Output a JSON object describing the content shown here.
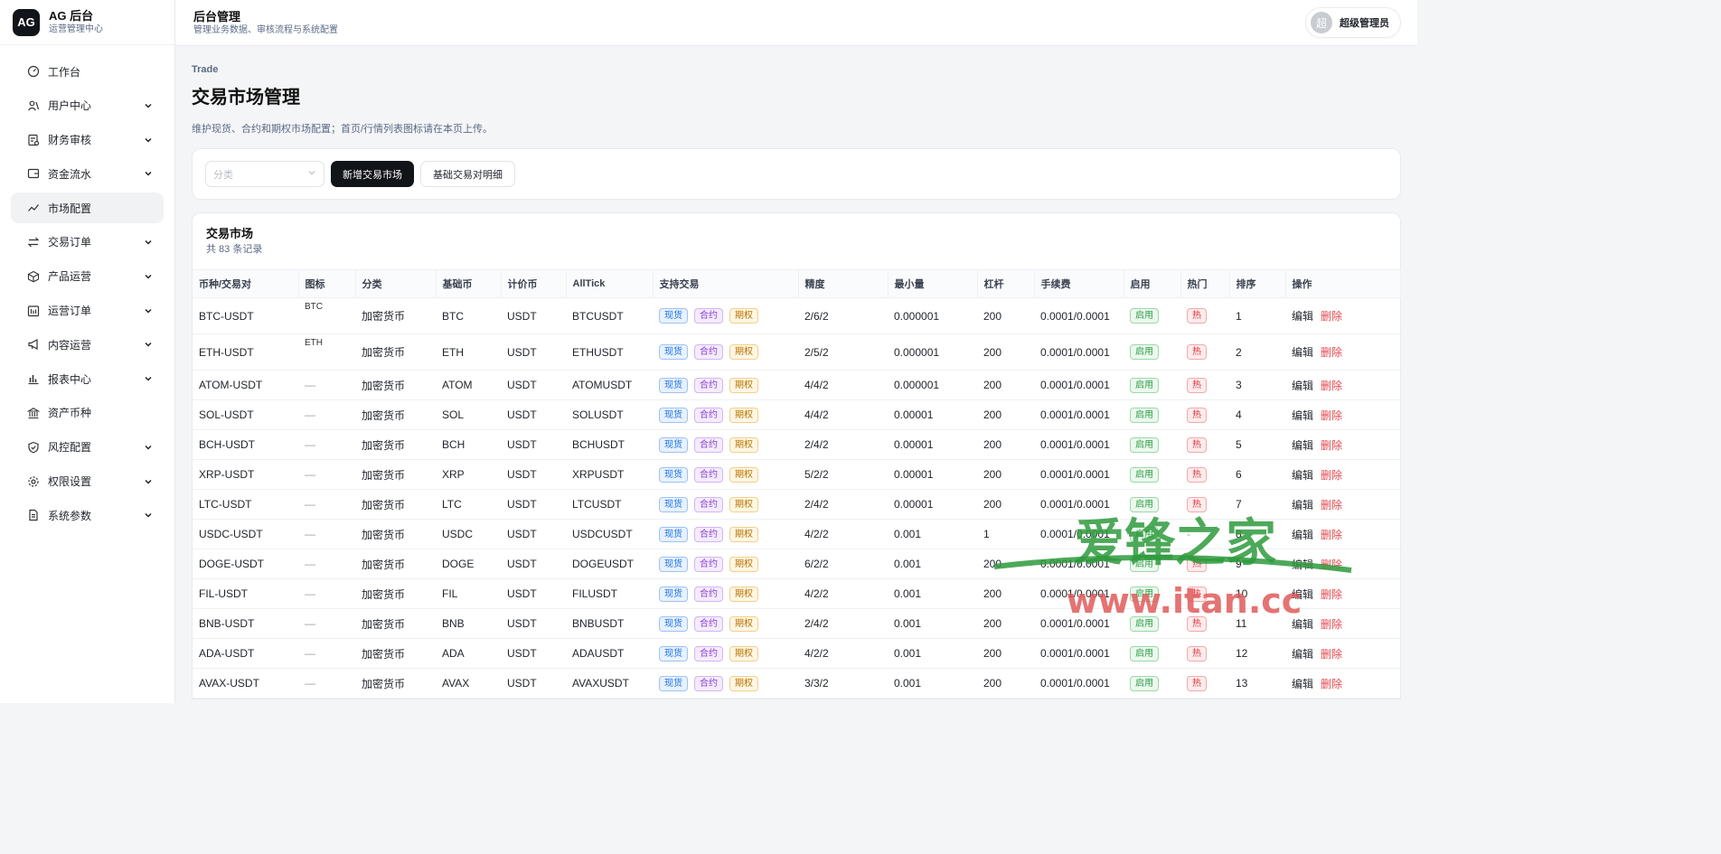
{
  "brand": {
    "logo": "AG",
    "title": "AG 后台",
    "subtitle": "运营管理中心"
  },
  "sidebar": {
    "items": [
      {
        "label": "工作台",
        "icon": "dashboard-icon",
        "expandable": false,
        "active": false
      },
      {
        "label": "用户中心",
        "icon": "users-icon",
        "expandable": true,
        "active": false
      },
      {
        "label": "财务审核",
        "icon": "finance-audit-icon",
        "expandable": true,
        "active": false
      },
      {
        "label": "资金流水",
        "icon": "wallet-icon",
        "expandable": true,
        "active": false
      },
      {
        "label": "市场配置",
        "icon": "chart-line-icon",
        "expandable": false,
        "active": true
      },
      {
        "label": "交易订单",
        "icon": "exchange-icon",
        "expandable": true,
        "active": false
      },
      {
        "label": "产品运营",
        "icon": "box-icon",
        "expandable": true,
        "active": false
      },
      {
        "label": "运营订单",
        "icon": "calendar-icon",
        "expandable": true,
        "active": false
      },
      {
        "label": "内容运营",
        "icon": "megaphone-icon",
        "expandable": true,
        "active": false
      },
      {
        "label": "报表中心",
        "icon": "bar-chart-icon",
        "expandable": true,
        "active": false
      },
      {
        "label": "资产币种",
        "icon": "bank-icon",
        "expandable": false,
        "active": false
      },
      {
        "label": "风控配置",
        "icon": "shield-icon",
        "expandable": true,
        "active": false
      },
      {
        "label": "权限设置",
        "icon": "gear-icon",
        "expandable": true,
        "active": false
      },
      {
        "label": "系统参数",
        "icon": "document-icon",
        "expandable": true,
        "active": false
      }
    ]
  },
  "topbar": {
    "title": "后台管理",
    "subtitle": "管理业务数据、审核流程与系统配置",
    "user_avatar": "超",
    "user_name": "超级管理员"
  },
  "page": {
    "breadcrumb": "Trade",
    "title": "交易市场管理",
    "description": "维护现货、合约和期权市场配置；首页/行情列表图标请在本页上传。"
  },
  "filters": {
    "category_placeholder": "分类",
    "add_button": "新增交易市场",
    "detail_button": "基础交易对明细"
  },
  "table": {
    "title": "交易市场",
    "count": "共 83 条记录",
    "columns": [
      "币种/交易对",
      "图标",
      "分类",
      "基础币",
      "计价币",
      "AllTick",
      "支持交易",
      "精度",
      "最小量",
      "杠杆",
      "手续费",
      "启用",
      "热门",
      "排序",
      "操作"
    ],
    "trade_tags": {
      "spot": "现货",
      "contract": "合约",
      "option": "期权"
    },
    "enabled_label": "启用",
    "hot_label": "热",
    "edit_label": "编辑",
    "delete_label": "删除",
    "rows": [
      {
        "pair": "BTC-USDT",
        "icon": "BTC",
        "category": "加密货币",
        "base": "BTC",
        "quote": "USDT",
        "alltick": "BTCUSDT",
        "precision": "2/6/2",
        "min": "0.000001",
        "leverage": "200",
        "fee": "0.0001/0.0001",
        "hot": "热",
        "sort": "1"
      },
      {
        "pair": "ETH-USDT",
        "icon": "ETH",
        "category": "加密货币",
        "base": "ETH",
        "quote": "USDT",
        "alltick": "ETHUSDT",
        "precision": "2/5/2",
        "min": "0.000001",
        "leverage": "200",
        "fee": "0.0001/0.0001",
        "hot": "热",
        "sort": "2"
      },
      {
        "pair": "ATOM-USDT",
        "icon": "—",
        "category": "加密货币",
        "base": "ATOM",
        "quote": "USDT",
        "alltick": "ATOMUSDT",
        "precision": "4/4/2",
        "min": "0.000001",
        "leverage": "200",
        "fee": "0.0001/0.0001",
        "hot": "热",
        "sort": "3"
      },
      {
        "pair": "SOL-USDT",
        "icon": "—",
        "category": "加密货币",
        "base": "SOL",
        "quote": "USDT",
        "alltick": "SOLUSDT",
        "precision": "4/4/2",
        "min": "0.00001",
        "leverage": "200",
        "fee": "0.0001/0.0001",
        "hot": "热",
        "sort": "4"
      },
      {
        "pair": "BCH-USDT",
        "icon": "—",
        "category": "加密货币",
        "base": "BCH",
        "quote": "USDT",
        "alltick": "BCHUSDT",
        "precision": "2/4/2",
        "min": "0.00001",
        "leverage": "200",
        "fee": "0.0001/0.0001",
        "hot": "热",
        "sort": "5"
      },
      {
        "pair": "XRP-USDT",
        "icon": "—",
        "category": "加密货币",
        "base": "XRP",
        "quote": "USDT",
        "alltick": "XRPUSDT",
        "precision": "5/2/2",
        "min": "0.00001",
        "leverage": "200",
        "fee": "0.0001/0.0001",
        "hot": "热",
        "sort": "6"
      },
      {
        "pair": "LTC-USDT",
        "icon": "—",
        "category": "加密货币",
        "base": "LTC",
        "quote": "USDT",
        "alltick": "LTCUSDT",
        "precision": "2/4/2",
        "min": "0.00001",
        "leverage": "200",
        "fee": "0.0001/0.0001",
        "hot": "热",
        "sort": "7"
      },
      {
        "pair": "USDC-USDT",
        "icon": "—",
        "category": "加密货币",
        "base": "USDC",
        "quote": "USDT",
        "alltick": "USDCUSDT",
        "precision": "4/2/2",
        "min": "0.001",
        "leverage": "1",
        "fee": "0.0001/0.0001",
        "hot": "-",
        "sort": "8"
      },
      {
        "pair": "DOGE-USDT",
        "icon": "—",
        "category": "加密货币",
        "base": "DOGE",
        "quote": "USDT",
        "alltick": "DOGEUSDT",
        "precision": "6/2/2",
        "min": "0.001",
        "leverage": "200",
        "fee": "0.0001/0.0001",
        "hot": "热",
        "sort": "9"
      },
      {
        "pair": "FIL-USDT",
        "icon": "—",
        "category": "加密货币",
        "base": "FIL",
        "quote": "USDT",
        "alltick": "FILUSDT",
        "precision": "4/2/2",
        "min": "0.001",
        "leverage": "200",
        "fee": "0.0001/0.0001",
        "hot": "热",
        "sort": "10"
      },
      {
        "pair": "BNB-USDT",
        "icon": "—",
        "category": "加密货币",
        "base": "BNB",
        "quote": "USDT",
        "alltick": "BNBUSDT",
        "precision": "2/4/2",
        "min": "0.001",
        "leverage": "200",
        "fee": "0.0001/0.0001",
        "hot": "热",
        "sort": "11"
      },
      {
        "pair": "ADA-USDT",
        "icon": "—",
        "category": "加密货币",
        "base": "ADA",
        "quote": "USDT",
        "alltick": "ADAUSDT",
        "precision": "4/2/2",
        "min": "0.001",
        "leverage": "200",
        "fee": "0.0001/0.0001",
        "hot": "热",
        "sort": "12"
      },
      {
        "pair": "AVAX-USDT",
        "icon": "—",
        "category": "加密货币",
        "base": "AVAX",
        "quote": "USDT",
        "alltick": "AVAXUSDT",
        "precision": "3/3/2",
        "min": "0.001",
        "leverage": "200",
        "fee": "0.0001/0.0001",
        "hot": "热",
        "sort": "13"
      }
    ]
  },
  "watermark": {
    "line1": "爱锋之家",
    "line2": "www.itan.cc"
  },
  "colors": {
    "accent": "#111418",
    "spot": "#1a73e8",
    "contract": "#8a3fd1",
    "option": "#b77400",
    "enabled": "#2f9e44",
    "hot": "#d9363e",
    "watermark_green": "#2e9a3c",
    "watermark_red": "#e05a5a"
  }
}
